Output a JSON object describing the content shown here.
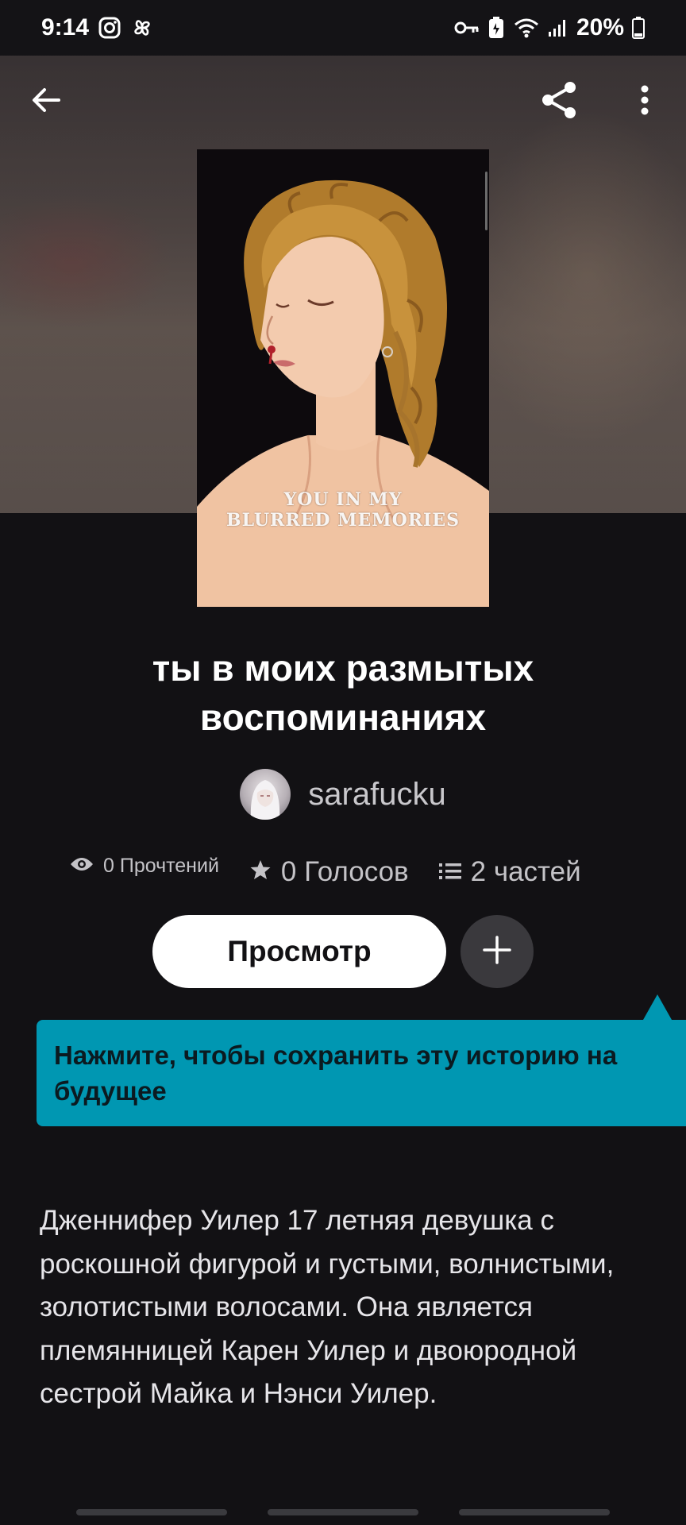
{
  "status_bar": {
    "time": "9:14",
    "battery": "20%",
    "left_icons": [
      "instagram-icon",
      "pinwheel-icon"
    ],
    "right_icons": [
      "key-icon",
      "battery-saver-icon",
      "wifi-icon",
      "signal-icon",
      "battery-icon"
    ]
  },
  "header": {
    "back_icon": "back-arrow-icon",
    "share_icon": "share-icon",
    "menu_icon": "more-vertical-icon"
  },
  "cover": {
    "text_line1": "YOU IN MY",
    "text_line2": "BLURRED MEMORIES"
  },
  "story": {
    "title": "ты в моих размытых воспоминаниях",
    "author": "sarafucku"
  },
  "stats": {
    "reads": "0 Прочтений",
    "votes": "0 Голосов",
    "parts": "2 частей"
  },
  "actions": {
    "read_label": "Просмотр",
    "add_icon": "plus-icon"
  },
  "tooltip": {
    "text": "Нажмите, чтобы сохранить эту историю на будущее"
  },
  "description": "Дженнифер Уилер 17 летняя девушка с роскошной фигурой и густыми, волнистыми, золотистыми волосами. Она является племянницей Карен Уилер и двоюродной сестрой Майка и Нэнси Уилер.",
  "colors": {
    "background": "#121114",
    "tooltip": "#0097b2",
    "button": "#ffffff"
  }
}
